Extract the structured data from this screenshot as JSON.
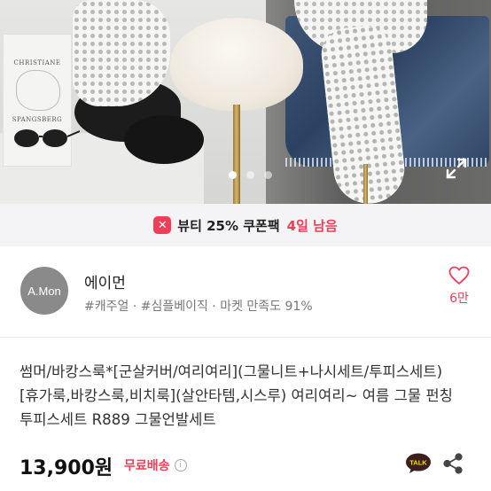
{
  "hero": {
    "book_line1": "CHRISTIANE",
    "book_line2": "SPANGSBERG",
    "carousel_count": 3,
    "carousel_active_index": 0
  },
  "coupon": {
    "icon": "coupon-x-icon",
    "text": "뷰티 25% 쿠폰팩",
    "days_left": "4일 남음",
    "accent_color": "#ef3e57"
  },
  "seller": {
    "avatar_text": "A.Mon",
    "name": "에이먼",
    "meta": "#캐주얼 · #심플베이직 · 마켓 만족도 91%",
    "likes": "6만"
  },
  "product": {
    "title": "썸머/바캉스룩*[군살커버/여리여리](그물니트+나시세트/투피스세트)[휴가룩,바캉스룩,비치룩](살안타템,시스루) 여리여리~ 여름 그물 펀칭 투피스세트 R889 그물언발세트",
    "price": "13,900원",
    "shipping": "무료배송",
    "shipping_info_icon": "info-icon"
  },
  "actions": {
    "kakao_talk_label": "TALK",
    "share_icon": "share-icon"
  }
}
